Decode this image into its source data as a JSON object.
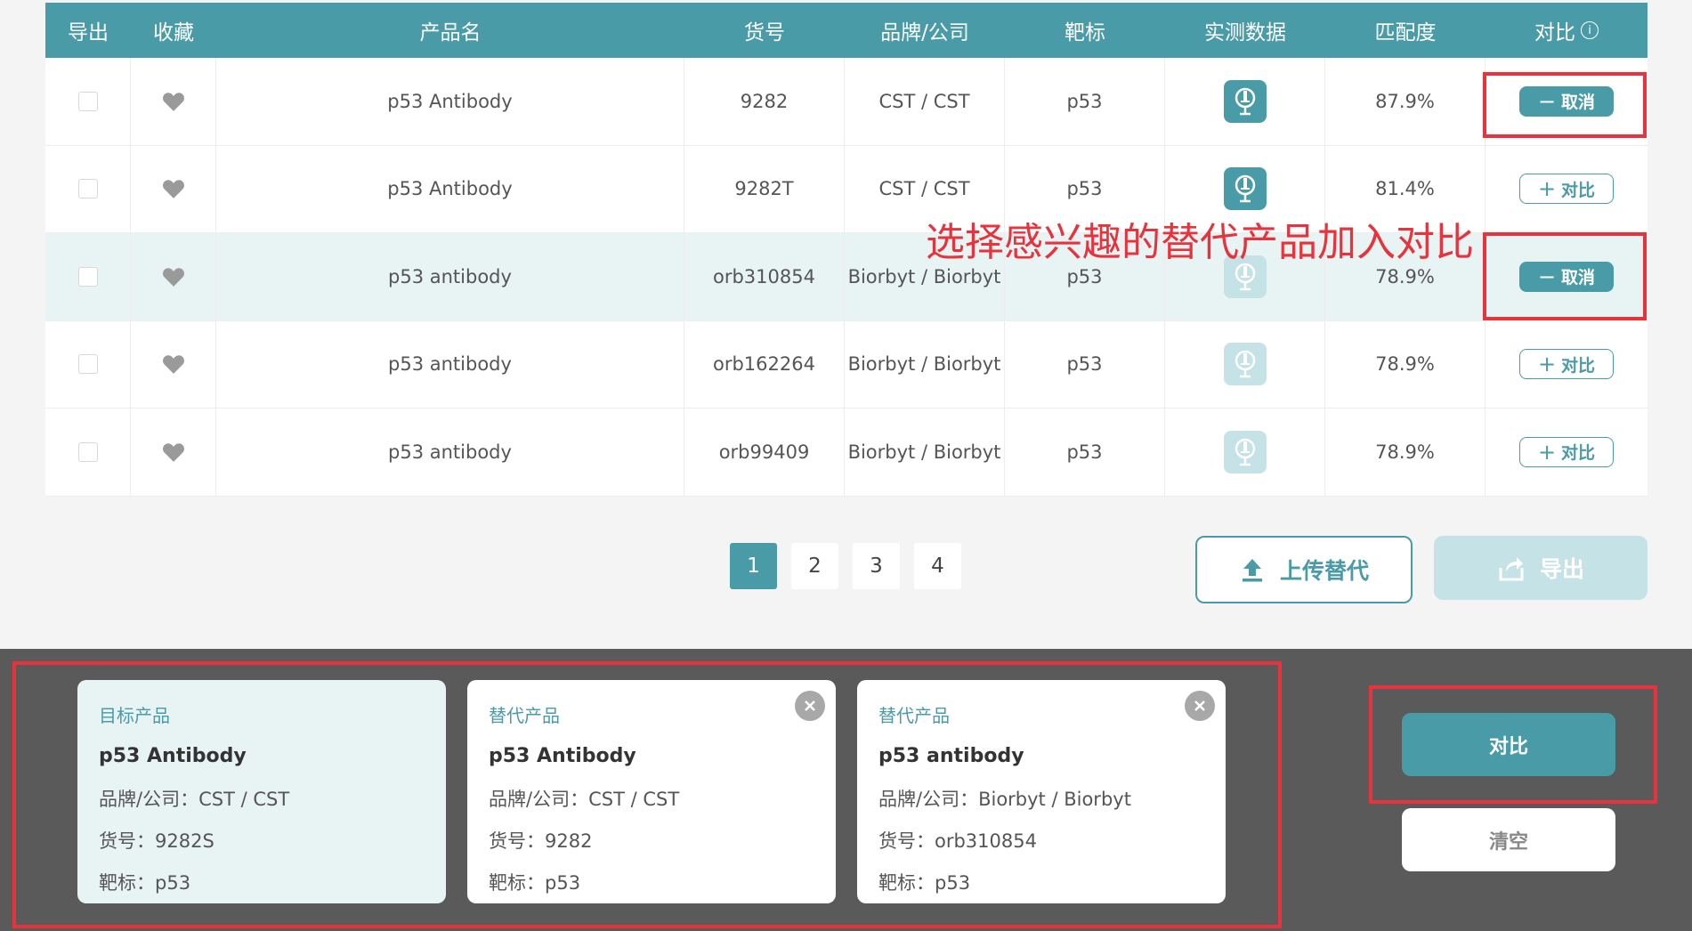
{
  "table": {
    "headers": {
      "export": "导出",
      "favorite": "收藏",
      "product": "产品名",
      "catalog": "货号",
      "brand": "品牌/公司",
      "target": "靶标",
      "data": "实测数据",
      "match": "匹配度",
      "compare": "对比"
    },
    "rows": [
      {
        "product": "p53 Antibody",
        "catalog": "9282",
        "brand": "CST / CST",
        "target": "p53",
        "match": "87.9%",
        "action": "取消",
        "action_symbol": "−",
        "data_icon": "microscope-icon",
        "data_active": true
      },
      {
        "product": "p53 Antibody",
        "catalog": "9282T",
        "brand": "CST / CST",
        "target": "p53",
        "match": "81.4%",
        "action": "对比",
        "action_symbol": "+",
        "data_icon": "microscope-icon",
        "data_active": true
      },
      {
        "product": "p53 antibody",
        "catalog": "orb310854",
        "brand": "Biorbyt / Biorbyt",
        "target": "p53",
        "match": "78.9%",
        "action": "取消",
        "action_symbol": "−",
        "data_icon": "microscope-icon",
        "data_active": false
      },
      {
        "product": "p53 antibody",
        "catalog": "orb162264",
        "brand": "Biorbyt / Biorbyt",
        "target": "p53",
        "match": "78.9%",
        "action": "对比",
        "action_symbol": "+",
        "data_icon": "microscope-icon",
        "data_active": false
      },
      {
        "product": "p53 antibody",
        "catalog": "orb99409",
        "brand": "Biorbyt / Biorbyt",
        "target": "p53",
        "match": "78.9%",
        "action": "对比",
        "action_symbol": "+",
        "data_icon": "microscope-icon",
        "data_active": false
      }
    ]
  },
  "annotation": "选择感兴趣的替代产品加入对比",
  "pagination": {
    "pages": [
      "1",
      "2",
      "3",
      "4"
    ],
    "current": "1"
  },
  "buttons": {
    "upload": "上传替代",
    "export": "导出",
    "compare": "对比",
    "clear": "清空"
  },
  "compare_cards": [
    {
      "type": "目标产品",
      "name": "p53 Antibody",
      "brand_label": "品牌/公司：",
      "brand": "CST / CST",
      "catalog_label": "货号：",
      "catalog": "9282S",
      "target_label": "靶标：",
      "target": "p53"
    },
    {
      "type": "替代产品",
      "name": "p53 Antibody",
      "brand_label": "品牌/公司：",
      "brand": "CST / CST",
      "catalog_label": "货号：",
      "catalog": "9282",
      "target_label": "靶标：",
      "target": "p53"
    },
    {
      "type": "替代产品",
      "name": "p53 antibody",
      "brand_label": "品牌/公司：",
      "brand": "Biorbyt / Biorbyt",
      "catalog_label": "货号：",
      "catalog": "orb310854",
      "target_label": "靶标：",
      "target": "p53"
    }
  ],
  "colors": {
    "accent": "#4a9ba8",
    "highlight": "#e8323c",
    "bottom_bar": "#5a5a5a"
  }
}
